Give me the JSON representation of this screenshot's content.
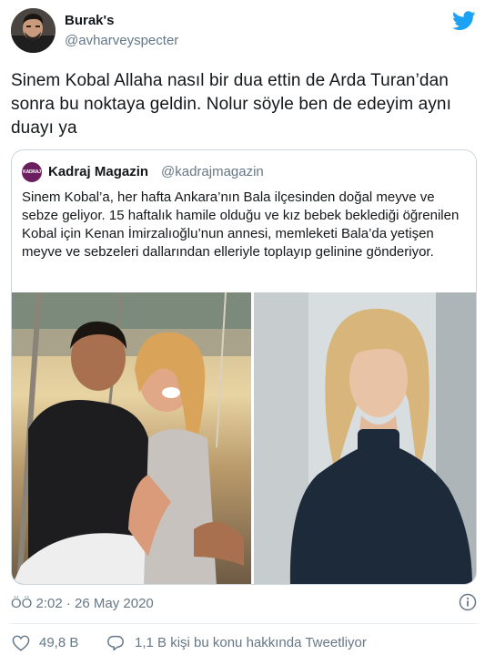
{
  "author": {
    "name": "Burak's",
    "handle": "@avharveyspecter"
  },
  "tweet": {
    "text": "Sinem Kobal Allaha nasıl bir dua ettin de Arda Turan’dan sonra bu noktaya geldin. Nolur söyle ben de edeyim aynı duayı ya"
  },
  "quote": {
    "avatar_label": "KADRAJ",
    "name": "Kadraj Magazin",
    "handle": "@kadrajmagazin",
    "text": "Sinem Kobal’a, her hafta Ankara’nın Bala ilçesinden doğal meyve ve sebze geliyor. 15 haftalık hamile olduğu ve kız bebek beklediği öğrenilen Kobal için Kenan İmirzalıoğlu’nun annesi, memleketi Bala’da yetişen meyve ve sebzeleri dallarından elleriyle toplayıp gelinine gönderiyor."
  },
  "meta": {
    "timestamp": "ÖÖ 2:02 · 26 May 2020"
  },
  "actions": {
    "like_count": "49,8 B",
    "reply_text": "1,1 B kişi bu konu hakkında Tweetliyor"
  },
  "colors": {
    "twitter_blue": "#1da1f2",
    "secondary_text": "#657786",
    "border": "#ccd6dd"
  },
  "icons": {
    "brand": "twitter-bird-icon",
    "info": "info-icon",
    "like": "heart-icon",
    "reply": "speech-bubble-icon"
  }
}
